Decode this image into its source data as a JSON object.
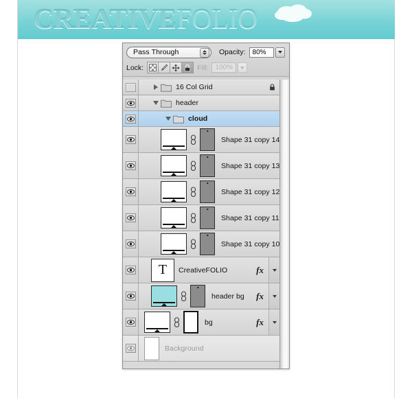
{
  "site": {
    "logo_bold": "CREATIVE",
    "logo_light": "FOLIO",
    "cloud_icon": "cloud-icon",
    "header_color_top": "#a5e1e1",
    "header_color_bottom": "#62cbd0"
  },
  "panel": {
    "blend_mode": "Pass Through",
    "opacity_label": "Opacity:",
    "opacity_value": "80%",
    "lock_label": "Lock:",
    "fill_label": "Fill:",
    "fill_value": "100%",
    "lock_buttons": [
      {
        "name": "lock-transparent-pixels",
        "icon": "checkerboard-icon",
        "active": false
      },
      {
        "name": "lock-image-pixels",
        "icon": "brush-icon",
        "active": false
      },
      {
        "name": "lock-position",
        "icon": "move-icon",
        "active": false
      },
      {
        "name": "lock-all",
        "icon": "lock-icon",
        "active": true
      }
    ],
    "layers": [
      {
        "name": "16 Col Grid",
        "type": "group",
        "visible": false,
        "expanded": false,
        "selected": false,
        "locked": true,
        "indent": 0,
        "fx": false
      },
      {
        "name": "header",
        "type": "group",
        "visible": true,
        "expanded": true,
        "selected": false,
        "locked": false,
        "indent": 0,
        "fx": false
      },
      {
        "name": "cloud",
        "type": "group",
        "visible": true,
        "expanded": true,
        "selected": true,
        "locked": false,
        "indent": 1,
        "fx": false
      },
      {
        "name": "Shape 31 copy 14",
        "type": "shape",
        "visible": true,
        "selected": false,
        "indent": 2,
        "fx": false,
        "thumb": "white",
        "mask": "grey"
      },
      {
        "name": "Shape 31 copy 13",
        "type": "shape",
        "visible": true,
        "selected": false,
        "indent": 2,
        "fx": false,
        "thumb": "white",
        "mask": "grey"
      },
      {
        "name": "Shape 31 copy 12",
        "type": "shape",
        "visible": true,
        "selected": false,
        "indent": 2,
        "fx": false,
        "thumb": "white",
        "mask": "grey"
      },
      {
        "name": "Shape 31 copy 11",
        "type": "shape",
        "visible": true,
        "selected": false,
        "indent": 2,
        "fx": false,
        "thumb": "white",
        "mask": "grey"
      },
      {
        "name": "Shape 31 copy 10",
        "type": "shape",
        "visible": true,
        "selected": false,
        "indent": 2,
        "fx": false,
        "thumb": "white",
        "mask": "grey"
      },
      {
        "name": "CreativeFOLIO",
        "type": "text",
        "visible": true,
        "selected": false,
        "indent": 1,
        "fx": true,
        "thumb_glyph": "T"
      },
      {
        "name": "header bg",
        "type": "shape",
        "visible": true,
        "selected": false,
        "indent": 1,
        "fx": true,
        "thumb": "cyan",
        "mask": "grey"
      },
      {
        "name": "bg",
        "type": "shape",
        "visible": true,
        "selected": false,
        "indent": 0,
        "fx": true,
        "thumb": "white",
        "mask": "black"
      },
      {
        "name": "Background",
        "type": "background",
        "visible": true,
        "selected": false,
        "indent": 0,
        "fx": false,
        "dimmed": true,
        "thumb": "plain"
      }
    ]
  }
}
